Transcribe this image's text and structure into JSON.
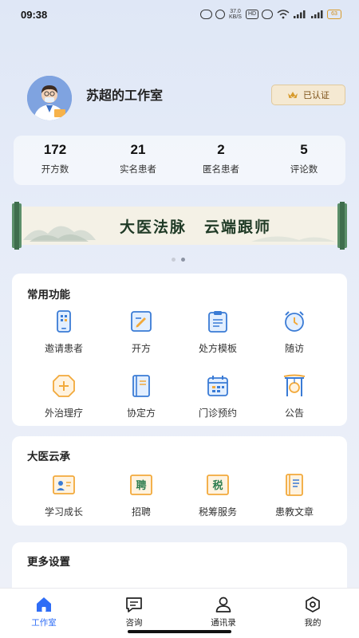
{
  "status_bar": {
    "time": "09:38",
    "speed": "37.0\nKB/S",
    "battery": "63"
  },
  "profile": {
    "studio_name": "苏超的工作室",
    "verify_label": "已认证"
  },
  "stats": [
    {
      "value": "172",
      "label": "开方数"
    },
    {
      "value": "21",
      "label": "实名患者"
    },
    {
      "value": "2",
      "label": "匿名患者"
    },
    {
      "value": "5",
      "label": "评论数"
    }
  ],
  "banner": {
    "text_left": "大医法脉",
    "text_right": "云端跟师",
    "slide_count": 2,
    "active_slide": 2
  },
  "common_functions": {
    "title": "常用功能",
    "items": [
      {
        "label": "邀请患者",
        "icon": "qr-phone-icon"
      },
      {
        "label": "开方",
        "icon": "prescribe-icon"
      },
      {
        "label": "处方模板",
        "icon": "template-icon"
      },
      {
        "label": "随访",
        "icon": "alarm-clock-icon"
      },
      {
        "label": "外治理疗",
        "icon": "therapy-icon"
      },
      {
        "label": "协定方",
        "icon": "book-icon"
      },
      {
        "label": "门诊预约",
        "icon": "calendar-icon"
      },
      {
        "label": "公告",
        "icon": "gong-icon"
      }
    ]
  },
  "dayi_yuncheng": {
    "title": "大医云承",
    "items": [
      {
        "label": "学习成长",
        "icon": "study-icon",
        "glyph": ""
      },
      {
        "label": "招聘",
        "icon": "recruit-icon",
        "glyph": "聘"
      },
      {
        "label": "税筹服务",
        "icon": "tax-icon",
        "glyph": "税"
      },
      {
        "label": "患教文章",
        "icon": "article-icon",
        "glyph": ""
      }
    ]
  },
  "more_settings": {
    "title": "更多设置"
  },
  "bottom_nav": [
    {
      "label": "工作室",
      "icon": "home-icon",
      "active": true
    },
    {
      "label": "咨询",
      "icon": "chat-icon",
      "active": false
    },
    {
      "label": "通讯录",
      "icon": "contacts-icon",
      "active": false
    },
    {
      "label": "我的",
      "icon": "profile-icon",
      "active": false
    }
  ],
  "colors": {
    "accent": "#2f6df6",
    "icon_blue": "#3a7bd5",
    "icon_orange": "#f2a93b",
    "verify_bg": "#f5e9d2",
    "verify_text": "#7a4e14"
  }
}
